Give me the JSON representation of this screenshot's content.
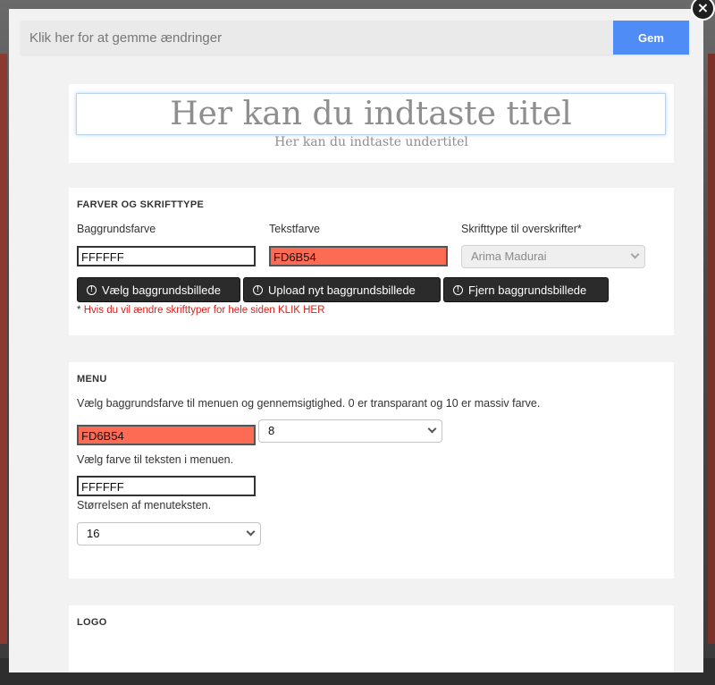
{
  "save_bar": {
    "placeholder": "Klik her for at gemme ændringer",
    "save_label": "Gem"
  },
  "close": {
    "glyph": "×",
    "icon": "close-icon"
  },
  "header": {
    "title": "Her kan du indtaste titel",
    "subtitle": "Her kan du indtaste undertitel"
  },
  "colors_section": {
    "heading": "FARVER OG SKRIFTTYPE",
    "background_label": "Baggrundsfarve",
    "background_value": "FFFFFF",
    "text_label": "Tekstfarve",
    "text_value": "FD6B54",
    "font_label": "Skrifttype til overskrifter*",
    "font_value": "Arima Madurai",
    "buttons": {
      "choose_bg": "Vælg baggrundsbillede",
      "upload_bg": "Upload nyt baggrundsbillede",
      "remove_bg": "Fjern baggrundsbillede"
    },
    "note_star": "*",
    "note": "Hvis du vil ændre skrifttyper for hele siden KLIK HER"
  },
  "menu_section": {
    "heading": "MENU",
    "bg_description": "Vælg baggrundsfarve til menuen og gennemsigtighed. 0 er transparant og 10 er massiv farve.",
    "bg_value": "FD6B54",
    "opacity_value": "8",
    "text_color_label": "Vælg farve til teksten i menuen.",
    "text_color_value": "FFFFFF",
    "size_label": "Størrelsen af menuteksten.",
    "size_value": "16"
  },
  "logo_section": {
    "heading": "LOGO"
  },
  "colors": {
    "accent": "#4f8cf6",
    "swatch": "#fd6b54",
    "warning": "#d9221c",
    "button_dark": "#2b2b2b"
  }
}
